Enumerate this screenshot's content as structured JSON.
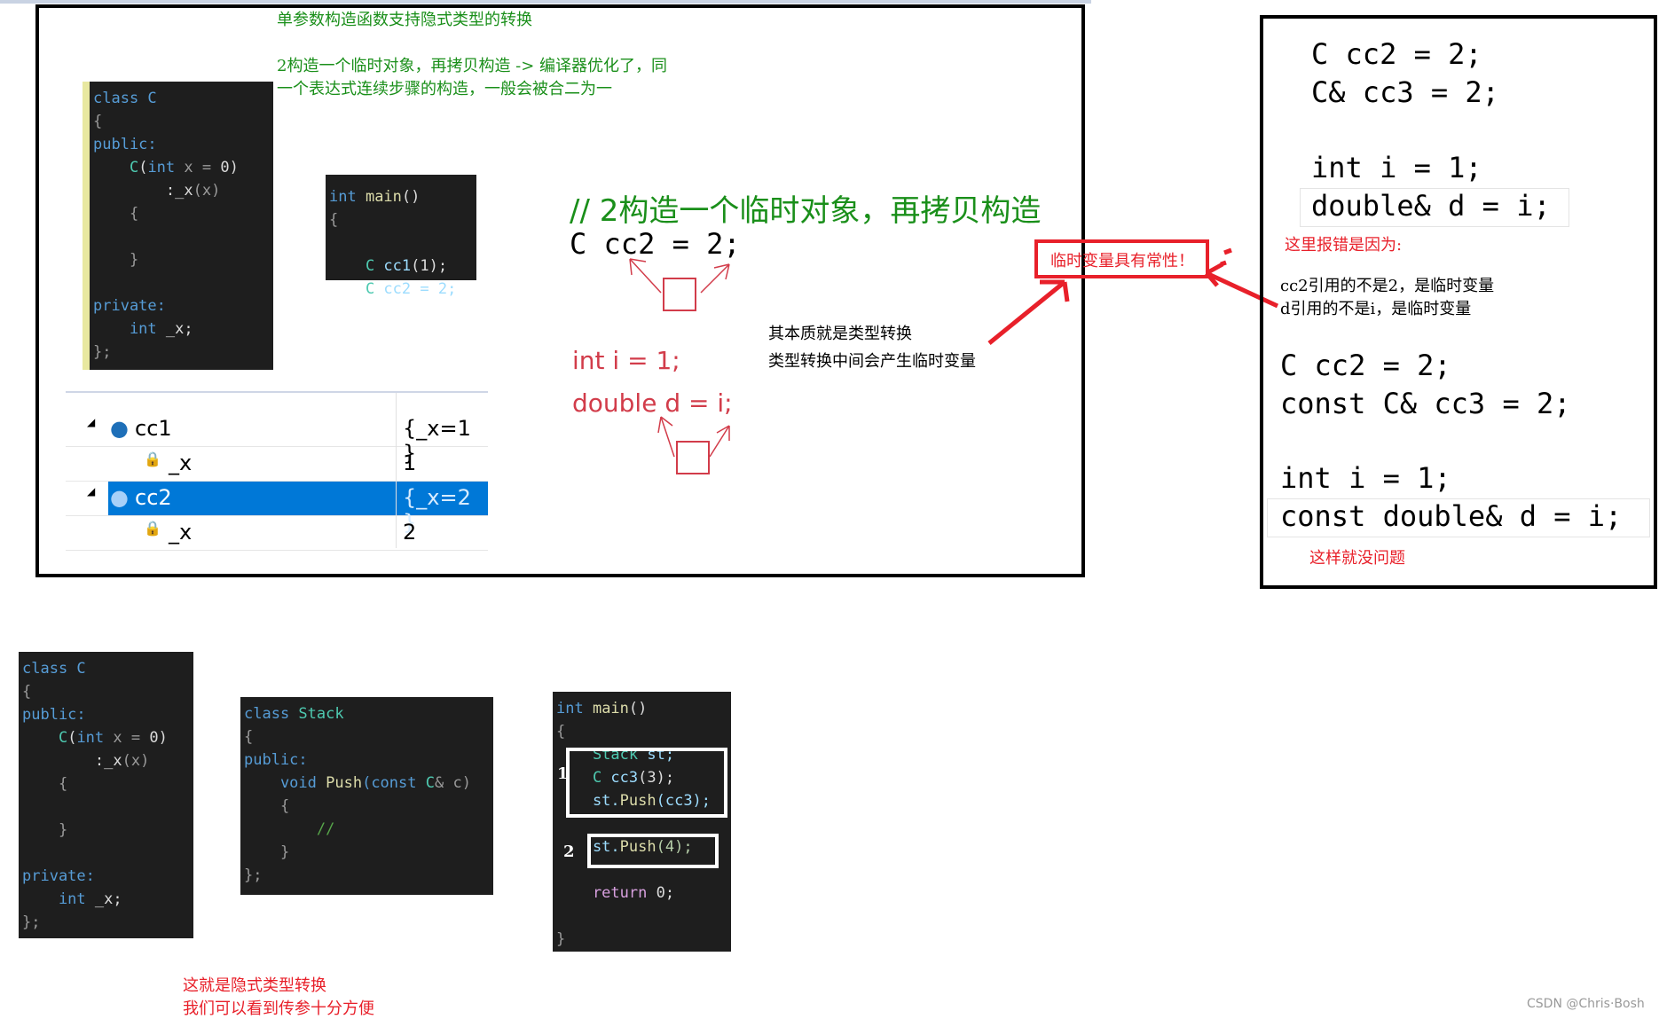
{
  "top_panel": {
    "title": "单参数构造函数支持隐式类型的转换",
    "note_line1": "2构造一个临时对象，再拷贝构造 -> 编译器优化了，同",
    "note_line2": "一个表达式连续步骤的构造，一般会被合二为一",
    "comment": "// 2构造一个临时对象，再拷贝构造",
    "stmt": "C cc2 = 2;",
    "red_int": "int i = 1;",
    "red_double": "double d = i;",
    "essence1": "其本质就是类型转换",
    "essence2": "类型转换中间会产生临时变量",
    "const_box": "临时变量具有常性！",
    "watch": {
      "rows": [
        {
          "name": "cc1",
          "value": "{_x=1 }"
        },
        {
          "name": "_x",
          "value": "1"
        },
        {
          "name": "cc2",
          "value": "{_x=2 }"
        },
        {
          "name": "_x",
          "value": "2"
        }
      ]
    }
  },
  "code_class_c": [
    [
      [
        "class C",
        "kw"
      ]
    ],
    [
      [
        "{",
        "pm"
      ]
    ],
    [
      [
        "public:",
        "kw"
      ]
    ],
    [
      [
        "    C",
        "ty"
      ],
      [
        "(",
        "pl"
      ],
      [
        "int",
        "kw"
      ],
      [
        " x = ",
        "pm"
      ],
      [
        "0)",
        "pl"
      ]
    ],
    [
      [
        "        :_x",
        "pl"
      ],
      [
        "(x)",
        "pm"
      ]
    ],
    [
      [
        "    {",
        "pm"
      ]
    ],
    [
      [
        "",
        ""
      ]
    ],
    [
      [
        "    }",
        "pm"
      ]
    ],
    [
      [
        "",
        ""
      ]
    ],
    [
      [
        "private:",
        "kw"
      ]
    ],
    [
      [
        "    int",
        "kw"
      ],
      [
        " _x;",
        "pl"
      ]
    ],
    [
      [
        "};",
        "pm"
      ]
    ]
  ],
  "code_main_small": [
    [
      [
        "int ",
        "kw"
      ],
      [
        "main",
        "fn"
      ],
      [
        "()",
        "pl"
      ]
    ],
    [
      [
        "{",
        "pm"
      ]
    ],
    [
      [
        "",
        ""
      ]
    ],
    [
      [
        "    C ",
        "ty"
      ],
      [
        "cc1",
        "vr"
      ],
      [
        "(1);",
        "pl"
      ]
    ],
    [
      [
        "    C ",
        "ty"
      ],
      [
        "cc2 = 2;",
        "vr"
      ]
    ]
  ],
  "code_stack": [
    [
      [
        "class ",
        "kw"
      ],
      [
        "Stack",
        "ty"
      ]
    ],
    [
      [
        "{",
        "pm"
      ]
    ],
    [
      [
        "public:",
        "kw"
      ]
    ],
    [
      [
        "    void ",
        "kw"
      ],
      [
        "Push",
        "fn"
      ],
      [
        "(const ",
        "kw"
      ],
      [
        "C",
        "ty"
      ],
      [
        "& c)",
        "pm"
      ]
    ],
    [
      [
        "    {",
        "pm"
      ]
    ],
    [
      [
        "        //",
        "cm"
      ]
    ],
    [
      [
        "    }",
        "pm"
      ]
    ],
    [
      [
        "};",
        "pm"
      ]
    ]
  ],
  "code_main": [
    [
      [
        "int ",
        "kw"
      ],
      [
        "main",
        "fn"
      ],
      [
        "()",
        "pl"
      ]
    ],
    [
      [
        "{",
        "pm"
      ]
    ],
    [
      [
        "    Stack ",
        "ty"
      ],
      [
        "st;",
        "vr"
      ]
    ],
    [
      [
        "    C ",
        "ty"
      ],
      [
        "cc3",
        "vr"
      ],
      [
        "(3);",
        "pl"
      ]
    ],
    [
      [
        "    st.",
        "vr"
      ],
      [
        "Push",
        "fn"
      ],
      [
        "(cc3);",
        "vr"
      ]
    ],
    [
      [
        "",
        ""
      ]
    ],
    [
      [
        "    st.",
        "vr"
      ],
      [
        "Push",
        "fn"
      ],
      [
        "(4);",
        "nm"
      ]
    ],
    [
      [
        "",
        ""
      ]
    ],
    [
      [
        "    return ",
        "rt"
      ],
      [
        "0;",
        "pl"
      ]
    ],
    [
      [
        "",
        ""
      ]
    ],
    [
      [
        "}",
        "pm"
      ]
    ]
  ],
  "labels": {
    "box1": "1",
    "box2": "2"
  },
  "right_panel": {
    "l1": "C cc2 = 2;",
    "l2": "C& cc3 = 2;",
    "l3": "int i = 1;",
    "l4": "double& d = i;",
    "reason": "这里报错是因为:",
    "r1": "cc2引用的不是2，是临时变量",
    "r2": "d引用的不是i，是临时变量",
    "l5": "C cc2 = 2;",
    "l6": "const C& cc3 = 2;",
    "l7": "int i = 1;",
    "l8": "const double& d = i;",
    "ok": "这样就没问题"
  },
  "bottom_note1": "这就是隐式类型转换",
  "bottom_note2": "我们可以看到传参十分方便",
  "watermark": "CSDN @Chris·Bosh",
  "colors": {
    "red": "#e8202a",
    "green": "#1a8f1a",
    "selection": "#0078d7"
  }
}
